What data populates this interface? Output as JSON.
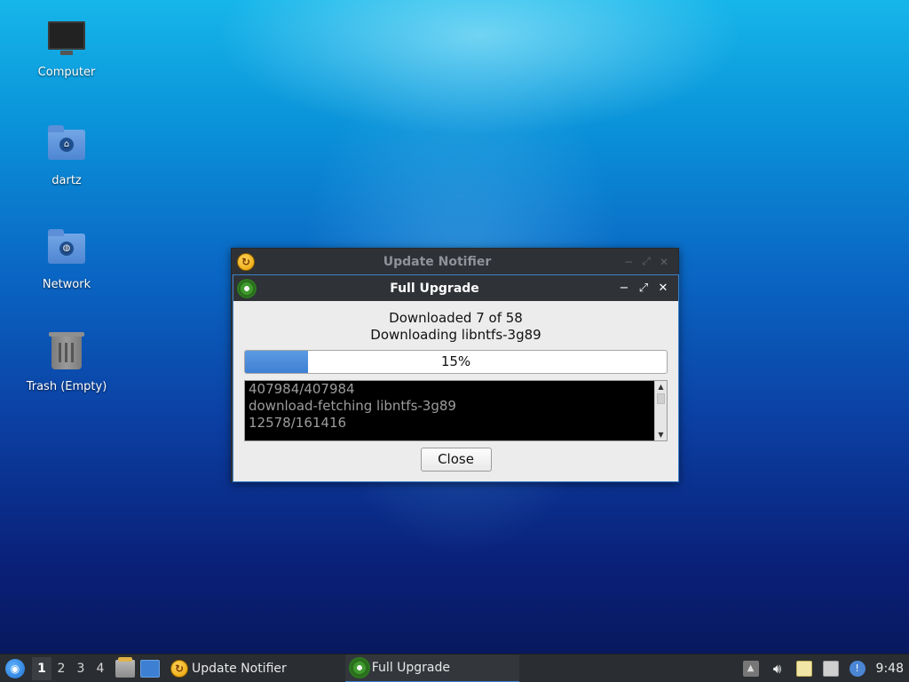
{
  "desktop": {
    "icons": [
      {
        "label": "Computer",
        "icon": "computer-icon"
      },
      {
        "label": "dartz",
        "icon": "home-folder-icon"
      },
      {
        "label": "Network",
        "icon": "network-folder-icon"
      },
      {
        "label": "Trash (Empty)",
        "icon": "trash-icon"
      }
    ]
  },
  "back_window": {
    "title": "Update Notifier",
    "icon": "update-notifier-icon"
  },
  "dialog": {
    "title": "Full Upgrade",
    "icon": "gear-icon",
    "status_line1": "Downloaded 7 of 58",
    "status_line2": "Downloading libntfs-3g89",
    "progress_value": 0.15,
    "progress_label": "15%",
    "log_lines": [
      "407984/407984",
      "download-fetching libntfs-3g89",
      "12578/161416"
    ],
    "close_label": "Close",
    "controls": {
      "minimize": "−",
      "maximize": "⤢",
      "close": "✕"
    }
  },
  "taskbar": {
    "workspaces": [
      "1",
      "2",
      "3",
      "4"
    ],
    "active_workspace": "1",
    "tasks": [
      {
        "label": "Update Notifier",
        "icon": "update-notifier-icon"
      },
      {
        "label": "Full Upgrade",
        "icon": "gear-icon"
      }
    ],
    "clock": "9:48"
  },
  "colors": {
    "accent": "#3d7fd2",
    "titlebar": "#2f3237"
  }
}
